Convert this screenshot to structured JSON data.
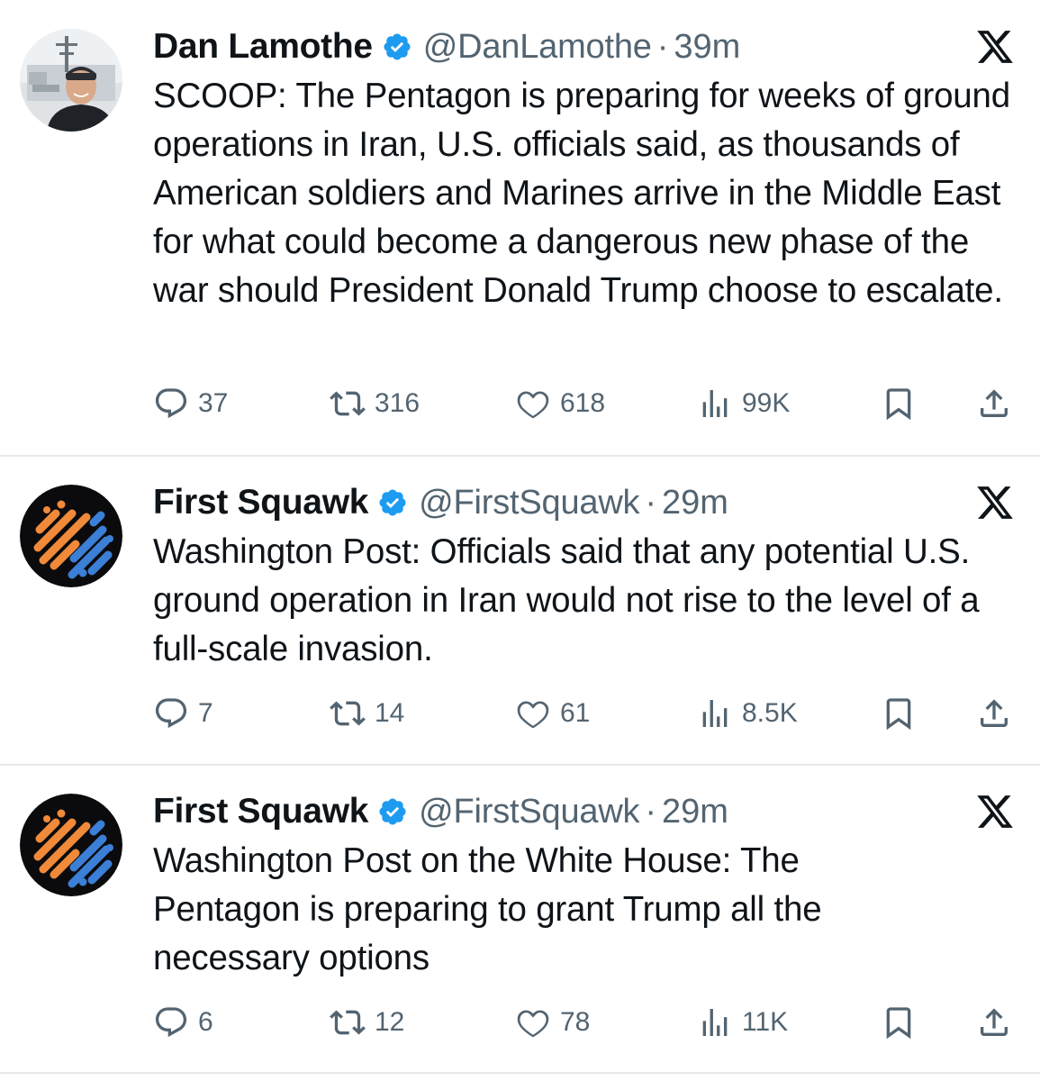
{
  "tweets": [
    {
      "display_name": "Dan Lamothe",
      "handle": "@DanLamothe",
      "separator": "·",
      "time": "39m",
      "text": "SCOOP: The Pentagon is preparing for weeks of ground operations in Iran, U.S. officials said, as thousands of American soldiers and Marines arrive in the Middle East for what could become a dangerous new phase of the war should President Donald Trump choose to escalate.",
      "replies": "37",
      "reposts": "316",
      "likes": "618",
      "views": "99K",
      "avatar": "person-photo"
    },
    {
      "display_name": "First Squawk",
      "handle": "@FirstSquawk",
      "separator": "·",
      "time": "29m",
      "text": "Washington Post: Officials said that any potential U.S. ground operation in Iran would not rise to the level of a full-scale invasion.",
      "replies": "7",
      "reposts": "14",
      "likes": "61",
      "views": "8.5K",
      "avatar": "first-squawk-logo"
    },
    {
      "display_name": "First Squawk",
      "handle": "@FirstSquawk",
      "separator": "·",
      "time": "29m",
      "text": "Washington Post on the White House: The Pentagon is preparing to grant Trump all the necessary options",
      "replies": "6",
      "reposts": "12",
      "likes": "78",
      "views": "11K",
      "avatar": "first-squawk-logo"
    }
  ],
  "icons": {
    "verified": "verified-badge-icon",
    "platform": "x-logo-icon",
    "reply": "reply-icon",
    "repost": "repost-icon",
    "like": "heart-icon",
    "views": "views-icon",
    "bookmark": "bookmark-icon",
    "share": "share-icon"
  },
  "colors": {
    "verified_blue": "#1d9bf0",
    "text": "#0f1419",
    "secondary": "#536471",
    "divider": "#e6e9ec",
    "squawk_orange": "#f08a3a",
    "squawk_blue": "#3b7fd6"
  }
}
